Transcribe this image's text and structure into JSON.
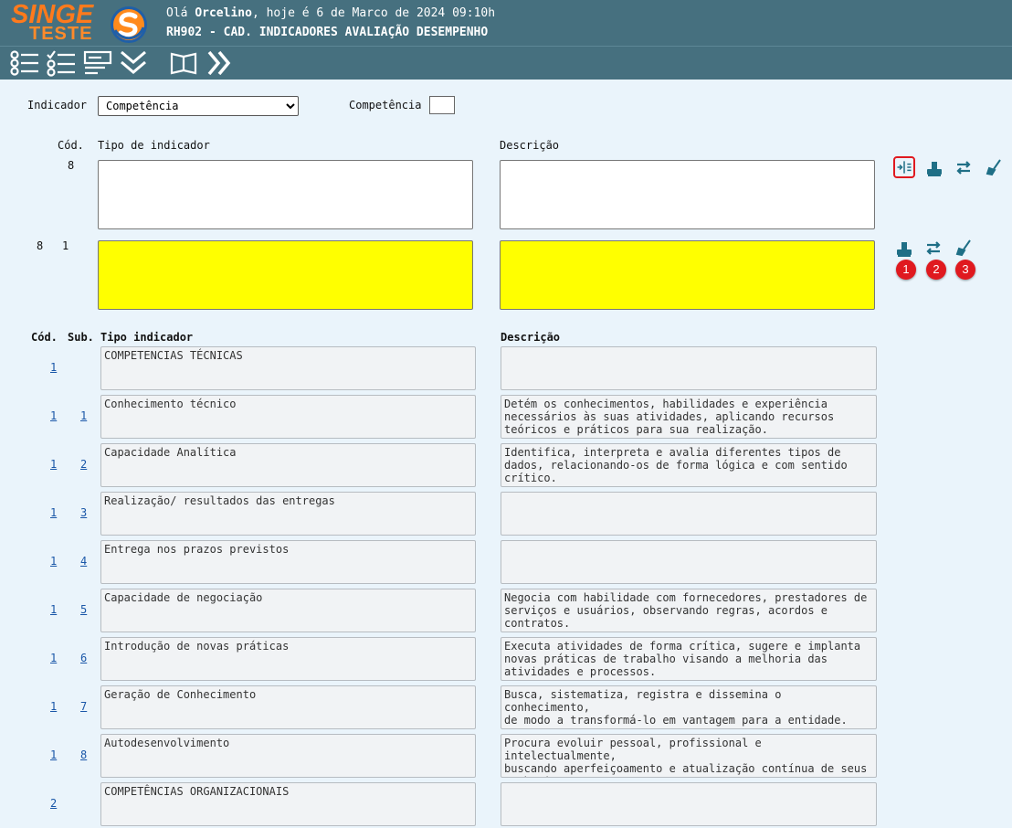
{
  "header": {
    "logo_top": "SINGE",
    "logo_bottom": "TESTE",
    "greeting_prefix": "Olá",
    "user": "Orcelino",
    "greeting_suffix": ", hoje é 6 de Marco de 2024 09:10h",
    "screen_title": "RH902 - CAD. INDICADORES AVALIAÇÃO DESEMPENHO"
  },
  "toolbar": {
    "buttons": [
      "list-icon",
      "checklist-icon",
      "form-icon",
      "double-chevron-down-icon",
      "book-icon",
      "double-chevron-right-icon"
    ]
  },
  "filter": {
    "indicador_label": "Indicador",
    "indicador_value": "Competência",
    "competencia_label": "Competência",
    "competencia_value": ""
  },
  "edit_form": {
    "cod_label": "Cód.",
    "tipo_label": "Tipo de indicador",
    "descricao_label": "Descrição",
    "new_row": {
      "cod": "8",
      "tipo": "",
      "descricao": ""
    },
    "edit_row": {
      "cod": "8",
      "sub": "1",
      "tipo": "",
      "descricao": ""
    },
    "badges": [
      "1",
      "2",
      "3"
    ]
  },
  "list": {
    "headers": {
      "cod": "Cód.",
      "sub": "Sub.",
      "tipo": "Tipo indicador",
      "descricao": "Descrição"
    },
    "rows": [
      {
        "cod": "1",
        "sub": "",
        "tipo": "COMPETENCIAS TÉCNICAS",
        "descricao": ""
      },
      {
        "cod": "1",
        "sub": "1",
        "tipo": "Conhecimento técnico",
        "descricao": "Detém os conhecimentos, habilidades e experiência\nnecessários às suas atividades, aplicando recursos\nteóricos e práticos para sua realização."
      },
      {
        "cod": "1",
        "sub": "2",
        "tipo": "Capacidade Analítica",
        "descricao": "Identifica, interpreta e avalia diferentes tipos de\ndados, relacionando-os de forma lógica e com sentido\ncrítico."
      },
      {
        "cod": "1",
        "sub": "3",
        "tipo": "Realização/ resultados das entregas",
        "descricao": ""
      },
      {
        "cod": "1",
        "sub": "4",
        "tipo": "Entrega nos prazos previstos",
        "descricao": ""
      },
      {
        "cod": "1",
        "sub": "5",
        "tipo": "Capacidade de negociação",
        "descricao": "Negocia com habilidade com fornecedores, prestadores de\nserviços e usuários, observando regras, acordos e\ncontratos."
      },
      {
        "cod": "1",
        "sub": "6",
        "tipo": "Introdução de novas práticas",
        "descricao": "Executa atividades de forma crítica, sugere e implanta\nnovas práticas de trabalho visando a melhoria das\natividades e processos."
      },
      {
        "cod": "1",
        "sub": "7",
        "tipo": "Geração de Conhecimento",
        "descricao": "Busca, sistematiza, registra e dissemina o conhecimento,\nde modo a transformá-lo em vantagem para a entidade."
      },
      {
        "cod": "1",
        "sub": "8",
        "tipo": "Autodesenvolvimento",
        "descricao": "Procura evoluir pessoal, profissional e intelectualmente,\nbuscando aperfeiçoamento e atualização contínua de seus\nconhecimentos."
      },
      {
        "cod": "2",
        "sub": "",
        "tipo": "COMPETÊNCIAS ORGANIZACIONAIS",
        "descricao": ""
      }
    ]
  },
  "colors": {
    "header_bg": "#46707f",
    "page_bg": "#eaf4fb",
    "edit_bg": "#ffff00",
    "badge": "#e0191f",
    "link": "#1a57a8"
  }
}
